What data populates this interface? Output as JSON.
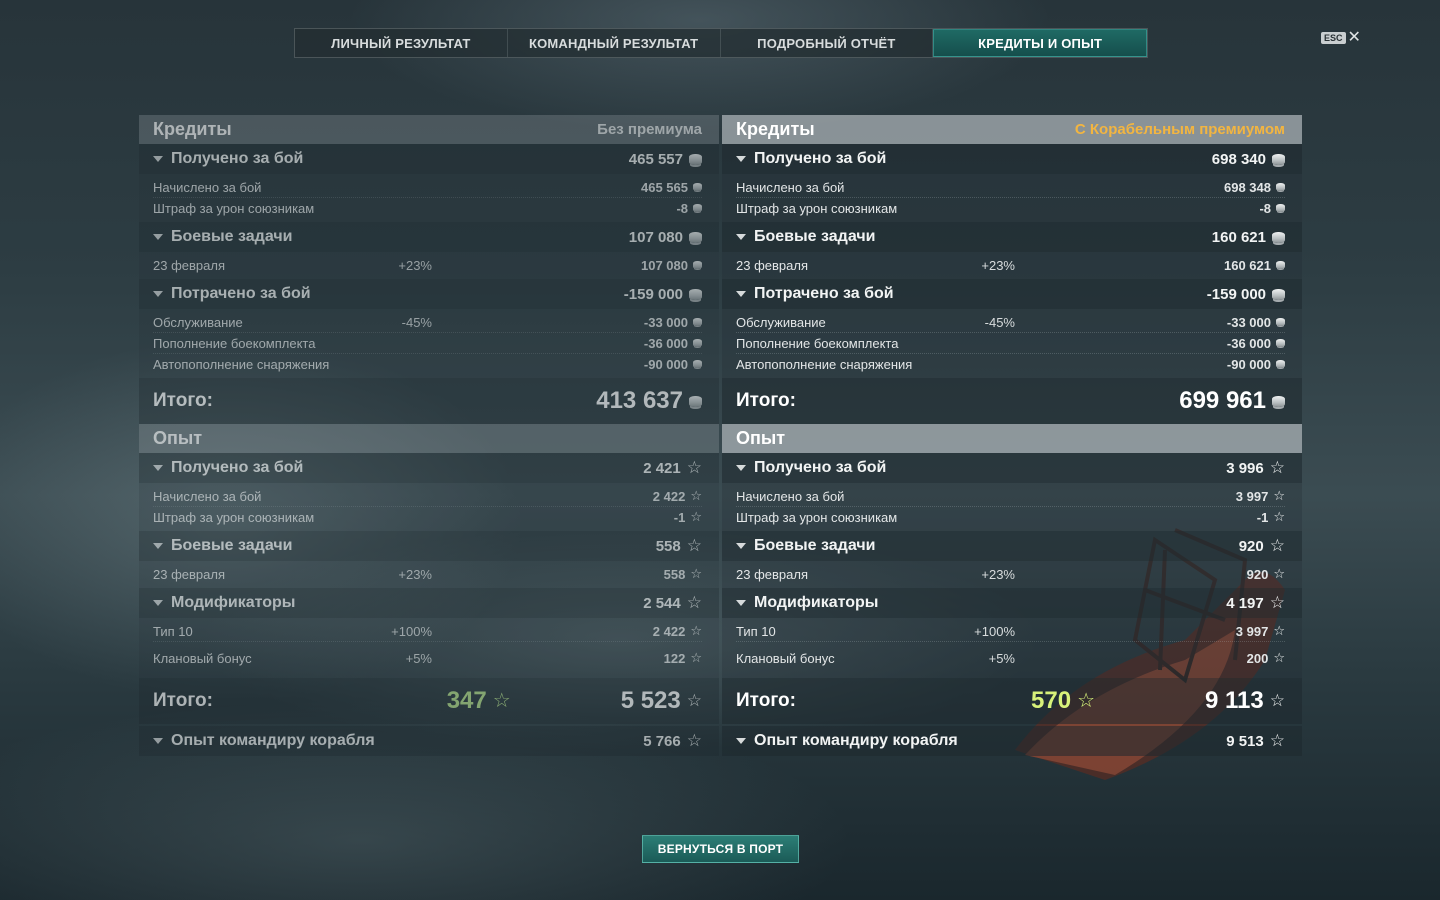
{
  "tabs": [
    {
      "label": "ЛИЧНЫЙ РЕЗУЛЬТАТ"
    },
    {
      "label": "КОМАНДНЫЙ РЕЗУЛЬТАТ"
    },
    {
      "label": "ПОДРОБНЫЙ ОТЧЁТ"
    },
    {
      "label": "КРЕДИТЫ И ОПЫТ"
    }
  ],
  "active_tab": "КРЕДИТЫ И ОПЫТ",
  "esc": "ESC",
  "accent_color": "#1f6a64",
  "premium_color": "#f2b541",
  "left": {
    "credits_title": "Кредиты",
    "credits_subtitle": "Без премиума",
    "earned_label": "Получено за бой",
    "earned_value": "465 557",
    "earned_sub": [
      {
        "name": "Начислено за бой",
        "value": "465 565"
      },
      {
        "name": "Штраф за урон союзникам",
        "value": "-8"
      }
    ],
    "tasks_label": "Боевые задачи",
    "tasks_value": "107 080",
    "tasks_sub": [
      {
        "name": "23 февраля",
        "pct": "+23%",
        "value": "107 080"
      }
    ],
    "spent_label": "Потрачено за бой",
    "spent_value": "-159 000",
    "spent_sub": [
      {
        "name": "Обслуживание",
        "pct": "-45%",
        "value": "-33 000"
      },
      {
        "name": "Пополнение боекомплекта",
        "value": "-36 000"
      },
      {
        "name": "Автопополнение снаряжения",
        "value": "-90 000"
      }
    ],
    "total_label": "Итого:",
    "total_credits": "413 637",
    "exp_title": "Опыт",
    "exp_earned_label": "Получено за бой",
    "exp_earned_value": "2 421",
    "exp_earned_sub": [
      {
        "name": "Начислено за бой",
        "value": "2 422"
      },
      {
        "name": "Штраф за урон союзникам",
        "value": "-1"
      }
    ],
    "exp_tasks_label": "Боевые задачи",
    "exp_tasks_value": "558",
    "exp_tasks_sub": [
      {
        "name": "23 февраля",
        "pct": "+23%",
        "value": "558"
      }
    ],
    "mods_label": "Модификаторы",
    "mods_value": "2 544",
    "mods_sub": [
      {
        "name": "Тип 10",
        "pct": "+100%",
        "value": "2 422"
      },
      {
        "name": "Клановый бонус",
        "pct": "+5%",
        "value": "122"
      }
    ],
    "exp_total_label": "Итого:",
    "exp_free": "347",
    "exp_total": "5 523",
    "commander_label": "Опыт командиру корабля",
    "commander_value": "5 766"
  },
  "right": {
    "credits_title": "Кредиты",
    "credits_subtitle": "С Корабельным премиумом",
    "earned_label": "Получено за бой",
    "earned_value": "698 340",
    "earned_sub": [
      {
        "name": "Начислено за бой",
        "value": "698 348"
      },
      {
        "name": "Штраф за урон союзникам",
        "value": "-8"
      }
    ],
    "tasks_label": "Боевые задачи",
    "tasks_value": "160 621",
    "tasks_sub": [
      {
        "name": "23 февраля",
        "pct": "+23%",
        "value": "160 621"
      }
    ],
    "spent_label": "Потрачено за бой",
    "spent_value": "-159 000",
    "spent_sub": [
      {
        "name": "Обслуживание",
        "pct": "-45%",
        "value": "-33 000"
      },
      {
        "name": "Пополнение боекомплекта",
        "value": "-36 000"
      },
      {
        "name": "Автопополнение снаряжения",
        "value": "-90 000"
      }
    ],
    "total_label": "Итого:",
    "total_credits": "699 961",
    "exp_title": "Опыт",
    "exp_earned_label": "Получено за бой",
    "exp_earned_value": "3 996",
    "exp_earned_sub": [
      {
        "name": "Начислено за бой",
        "value": "3 997"
      },
      {
        "name": "Штраф за урон союзникам",
        "value": "-1"
      }
    ],
    "exp_tasks_label": "Боевые задачи",
    "exp_tasks_value": "920",
    "exp_tasks_sub": [
      {
        "name": "23 февраля",
        "pct": "+23%",
        "value": "920"
      }
    ],
    "mods_label": "Модификаторы",
    "mods_value": "4 197",
    "mods_sub": [
      {
        "name": "Тип 10",
        "pct": "+100%",
        "value": "3 997"
      },
      {
        "name": "Клановый бонус",
        "pct": "+5%",
        "value": "200"
      }
    ],
    "exp_total_label": "Итого:",
    "exp_free": "570",
    "exp_total": "9 113",
    "commander_label": "Опыт командиру корабля",
    "commander_value": "9 513"
  },
  "return_button": "ВЕРНУТЬСЯ В ПОРТ"
}
